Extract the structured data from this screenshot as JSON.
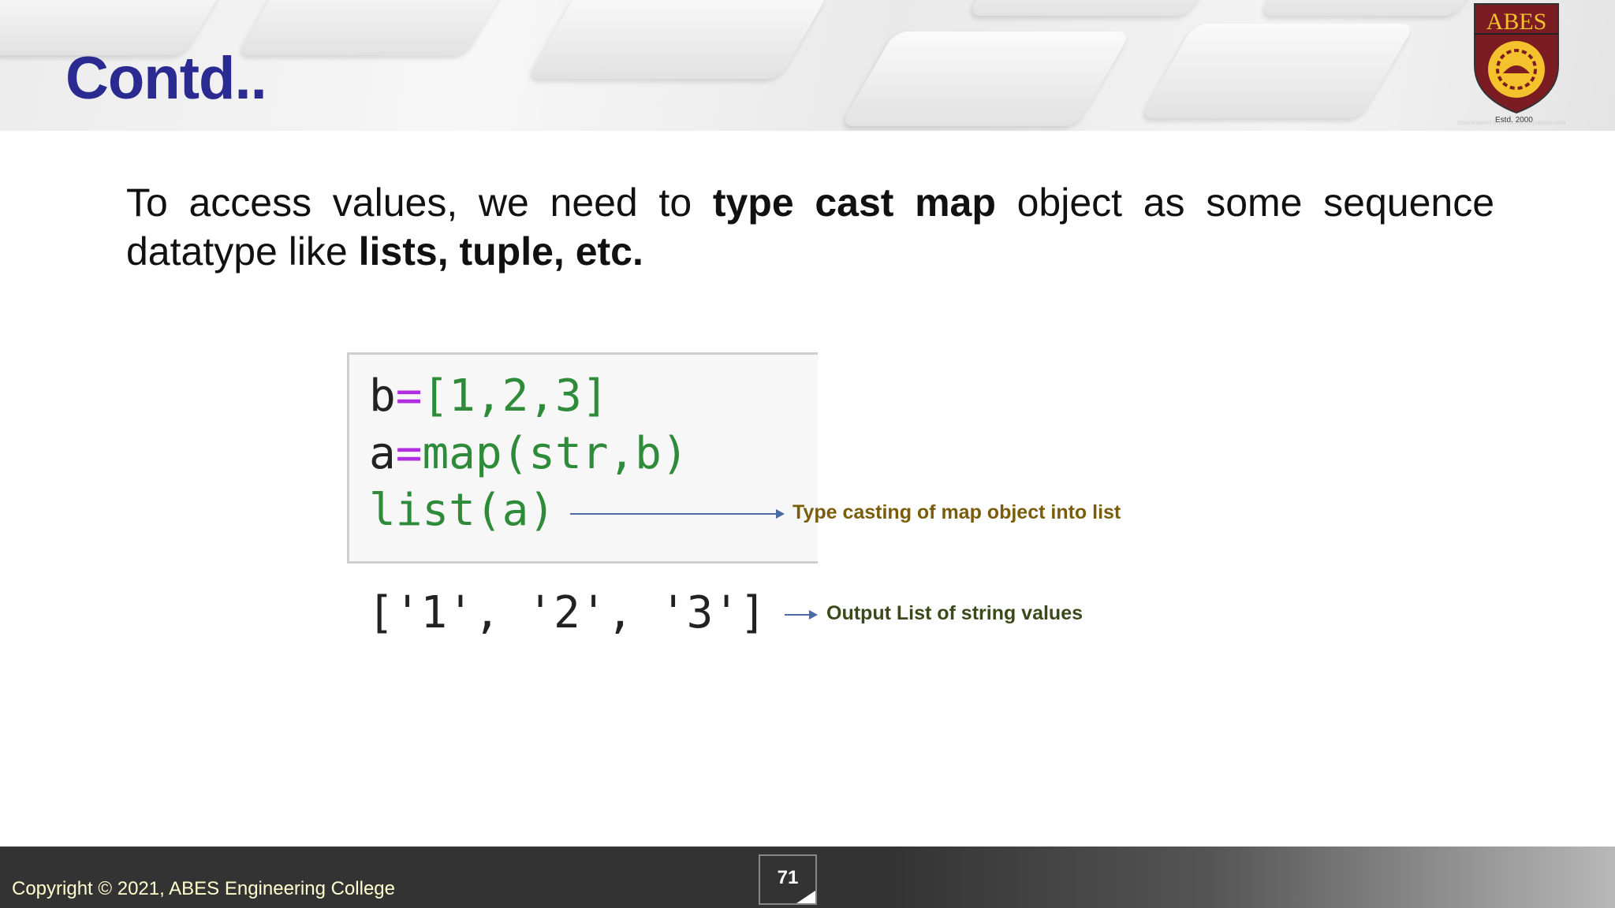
{
  "header": {
    "title": "Contd..",
    "logo_text": "ABES",
    "logo_estd": "Estd. 2000",
    "watermark": "downloaded from pickywallpapers.com"
  },
  "body": {
    "parts": [
      "To access values, we need to ",
      "type cast map",
      " object as some sequence datatype like ",
      "lists, tuple, etc."
    ]
  },
  "code": {
    "lines": [
      [
        "b",
        "=",
        "[1,2,3]"
      ],
      [
        "a",
        "=",
        "map(str,b)"
      ],
      [
        "list(a)"
      ]
    ],
    "output": "['1', '2', '3']"
  },
  "annotations": {
    "cast": "Type casting of map object into list",
    "output": "Output List of string values"
  },
  "colors": {
    "title": "#2a2a90",
    "cast_note": "#7a5d0a",
    "output_note": "#3b4a1a",
    "arrow": "#4a6aa8"
  },
  "footer": {
    "copyright": "Copyright © 2021, ABES Engineering College",
    "page_number": "71"
  }
}
